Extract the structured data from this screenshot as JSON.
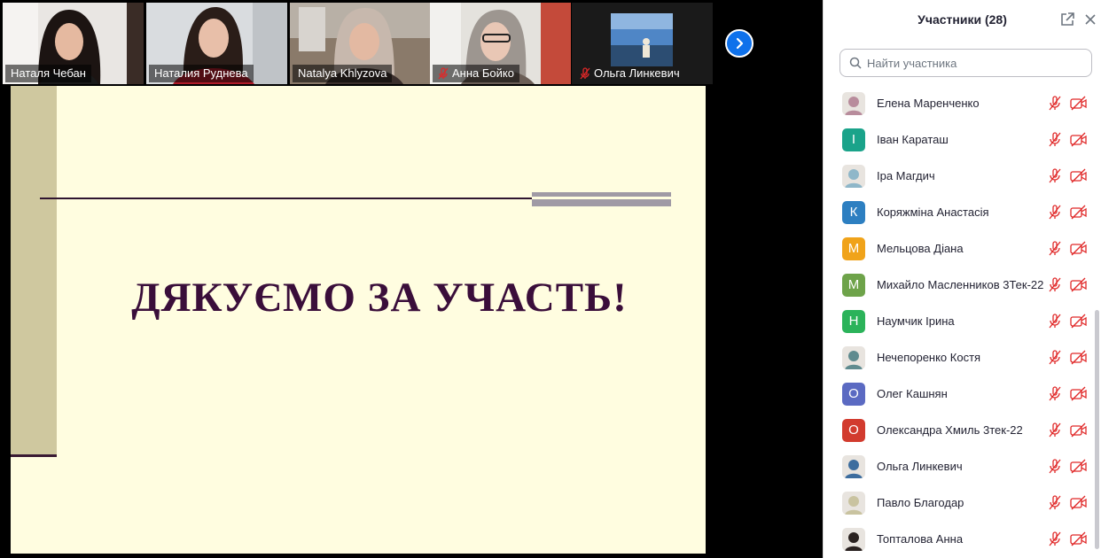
{
  "video_strip": {
    "tiles": [
      {
        "name": "Наталя Чебан",
        "muted": false,
        "active": false
      },
      {
        "name": "Наталия Руднева",
        "muted": false,
        "active": true
      },
      {
        "name": "Natalya Khlyzova",
        "muted": false,
        "active": false
      },
      {
        "name": "Анна Бойко",
        "muted": true,
        "active": false
      },
      {
        "name": "Ольга Линкевич",
        "muted": true,
        "active": false
      }
    ],
    "next_icon": "chevron-right-icon"
  },
  "slide": {
    "title": "ДЯКУЄМО ЗА УЧАСТЬ!"
  },
  "panel": {
    "title": "Участники (28)",
    "popout_icon": "popout-icon",
    "close_icon": "close-icon",
    "search_placeholder": "Найти участника",
    "participants": [
      {
        "name": "Елена Маренченко",
        "avatar": "photo",
        "initial": "",
        "color": "#b88c9c"
      },
      {
        "name": "Іван Караташ",
        "avatar": "letter",
        "initial": "І",
        "color": "#1aa38a"
      },
      {
        "name": "Іра Магдич",
        "avatar": "photo",
        "initial": "",
        "color": "#8fb7c9"
      },
      {
        "name": "Коряжміна Анастасія",
        "avatar": "letter",
        "initial": "К",
        "color": "#2d7fc1"
      },
      {
        "name": "Мельцова Діана",
        "avatar": "letter",
        "initial": "М",
        "color": "#f0a31a"
      },
      {
        "name": "Михайло Масленников 3Тек-22",
        "avatar": "letter",
        "initial": "М",
        "color": "#6ea34a"
      },
      {
        "name": "Наумчик Ірина",
        "avatar": "letter",
        "initial": "Н",
        "color": "#2bb35a"
      },
      {
        "name": "Нечепоренко Костя",
        "avatar": "photo",
        "initial": "",
        "color": "#5f8b8f"
      },
      {
        "name": "Олег Кашнян",
        "avatar": "letter",
        "initial": "О",
        "color": "#5b6ac2"
      },
      {
        "name": "Олександра Хмиль 3тек-22",
        "avatar": "letter",
        "initial": "О",
        "color": "#d23b2e"
      },
      {
        "name": "Ольга Линкевич",
        "avatar": "photo",
        "initial": "",
        "color": "#3d6d9e"
      },
      {
        "name": "Павло Благодар",
        "avatar": "photo",
        "initial": "",
        "color": "#c9c3a0"
      },
      {
        "name": "Топталова Анна",
        "avatar": "photo",
        "initial": "",
        "color": "#2a2220"
      }
    ],
    "row_icons": [
      "mic-muted-icon",
      "video-off-icon"
    ],
    "status_color": "#e02828"
  }
}
